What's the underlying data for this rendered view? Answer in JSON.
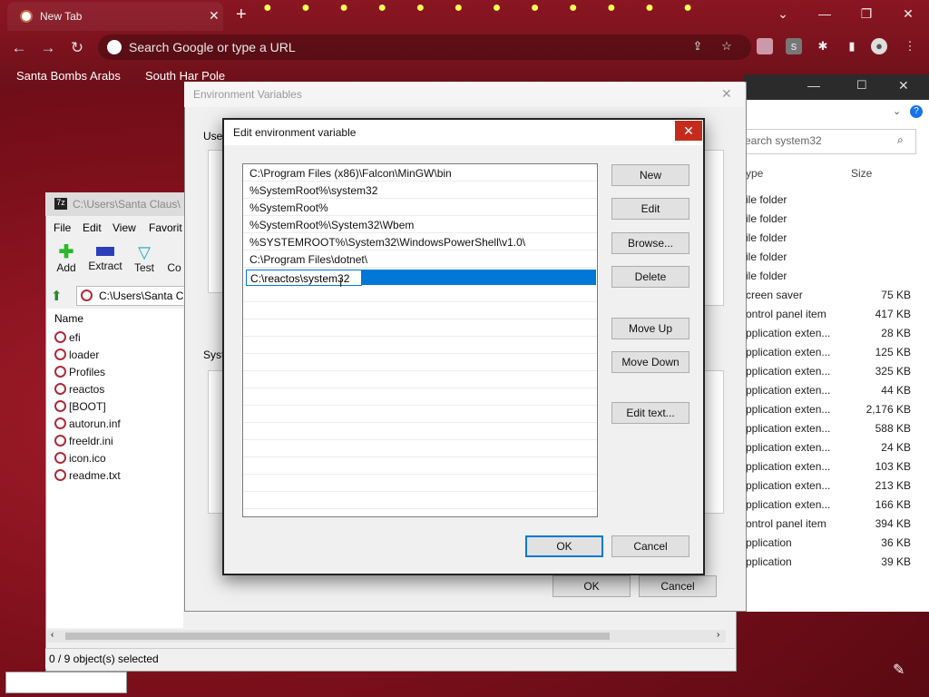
{
  "chrome": {
    "tab_title": "New Tab",
    "omnibox_placeholder": "Search Google or type a URL",
    "bookmarks": [
      "Santa Bombs Arabs",
      "South Har Pole"
    ],
    "colors": {
      "bar": "#8a1622"
    }
  },
  "explorer": {
    "search_placeholder": "earch system32",
    "col_type": "ype",
    "col_size": "Size",
    "rows": [
      {
        "type": "ile folder",
        "size": ""
      },
      {
        "type": "ile folder",
        "size": ""
      },
      {
        "type": "ile folder",
        "size": ""
      },
      {
        "type": "ile folder",
        "size": ""
      },
      {
        "type": "ile folder",
        "size": ""
      },
      {
        "type": "creen saver",
        "size": "75 KB"
      },
      {
        "type": "ontrol panel item",
        "size": "417 KB"
      },
      {
        "type": "pplication exten...",
        "size": "28 KB"
      },
      {
        "type": "pplication exten...",
        "size": "125 KB"
      },
      {
        "type": "pplication exten...",
        "size": "325 KB"
      },
      {
        "type": "pplication exten...",
        "size": "44 KB"
      },
      {
        "type": "pplication exten...",
        "size": "2,176 KB"
      },
      {
        "type": "pplication exten...",
        "size": "588 KB"
      },
      {
        "type": "pplication exten...",
        "size": "24 KB"
      },
      {
        "type": "pplication exten...",
        "size": "103 KB"
      },
      {
        "type": "pplication exten...",
        "size": "213 KB"
      },
      {
        "type": "pplication exten...",
        "size": "166 KB"
      },
      {
        "type": "ontrol panel item",
        "size": "394 KB"
      },
      {
        "type": "pplication",
        "size": "36 KB"
      },
      {
        "type": "pplication",
        "size": "39 KB"
      }
    ]
  },
  "sevenzip": {
    "title": "C:\\Users\\Santa Claus\\",
    "menu": [
      "File",
      "Edit",
      "View",
      "Favorit"
    ],
    "tools": [
      "Add",
      "Extract",
      "Test",
      "Co"
    ],
    "address": "C:\\Users\\Santa Cl",
    "col_name": "Name",
    "items": [
      "efi",
      "loader",
      "Profiles",
      "reactos",
      "[BOOT]",
      "autorun.inf",
      "freeldr.ini",
      "icon.ico",
      "readme.txt"
    ],
    "status": "0 / 9 object(s) selected"
  },
  "envvars": {
    "title": "Environment Variables",
    "user_label": "Use",
    "system_label": "Syst",
    "ok": "OK",
    "cancel": "Cancel"
  },
  "edit_dialog": {
    "title": "Edit environment variable",
    "paths": [
      "C:\\Program Files (x86)\\Falcon\\MinGW\\bin",
      "%SystemRoot%\\system32",
      "%SystemRoot%",
      "%SystemRoot%\\System32\\Wbem",
      "%SYSTEMROOT%\\System32\\WindowsPowerShell\\v1.0\\",
      "C:\\Program Files\\dotnet\\"
    ],
    "editing_value": "C:\\reactos\\system32",
    "buttons": {
      "new": "New",
      "edit": "Edit",
      "browse": "Browse...",
      "delete": "Delete",
      "move_up": "Move Up",
      "move_down": "Move Down",
      "edit_text": "Edit text...",
      "ok": "OK",
      "cancel": "Cancel"
    },
    "colors": {
      "selection": "#0078d7",
      "close": "#c42b1c"
    }
  }
}
